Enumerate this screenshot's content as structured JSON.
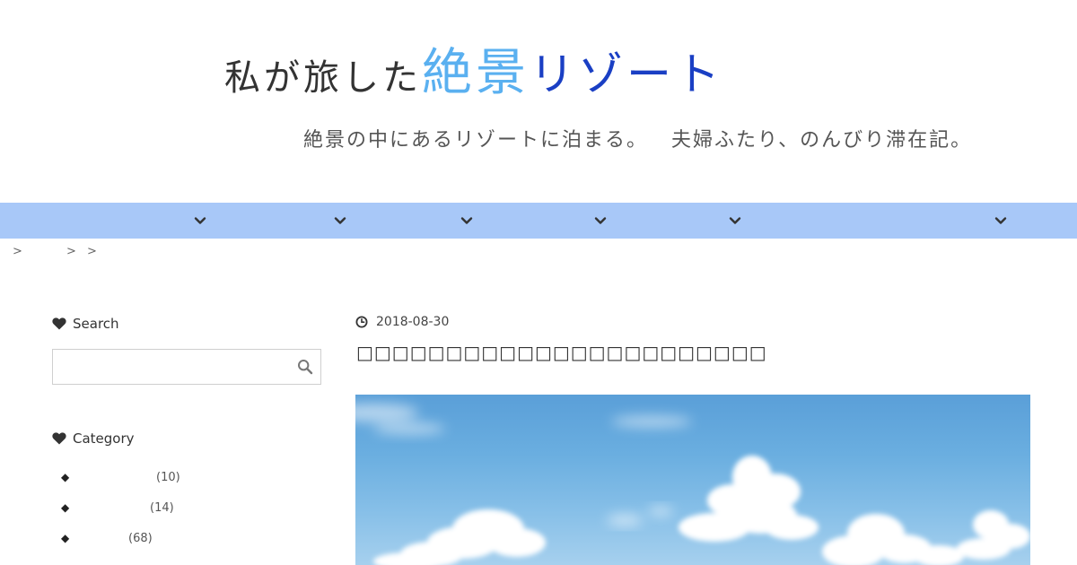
{
  "site": {
    "logo_part1": "私が旅した",
    "logo_part2": "絶景",
    "logo_part3": "リゾート",
    "tagline_part1": "絶景の中にあるリゾートに泊まる。",
    "tagline_part2": "夫婦ふたり、のんびり滞在記。"
  },
  "nav": {
    "items": [
      {
        "icon": "chevron-down-icon"
      },
      {
        "icon": "chevron-down-icon"
      },
      {
        "icon": "chevron-down-icon"
      },
      {
        "icon": "chevron-down-icon"
      },
      {
        "icon": "chevron-down-icon"
      },
      {
        "icon": "chevron-down-icon"
      }
    ]
  },
  "breadcrumb": {
    "separators": [
      ">",
      ">",
      ">"
    ]
  },
  "sidebar": {
    "search_heading": "Search",
    "search_placeholder": "",
    "category_heading": "Category",
    "categories": [
      {
        "count": "(10)"
      },
      {
        "count": "(14)"
      },
      {
        "count": "(68)"
      }
    ]
  },
  "post": {
    "date": "2018-08-30",
    "title": "□□□□□□□□□□□□□□□□□□□□□□□"
  },
  "colors": {
    "nav_bg": "#a8c8f8",
    "logo_blue": "#5ab0f0",
    "logo_navy": "#1a3fc4"
  }
}
